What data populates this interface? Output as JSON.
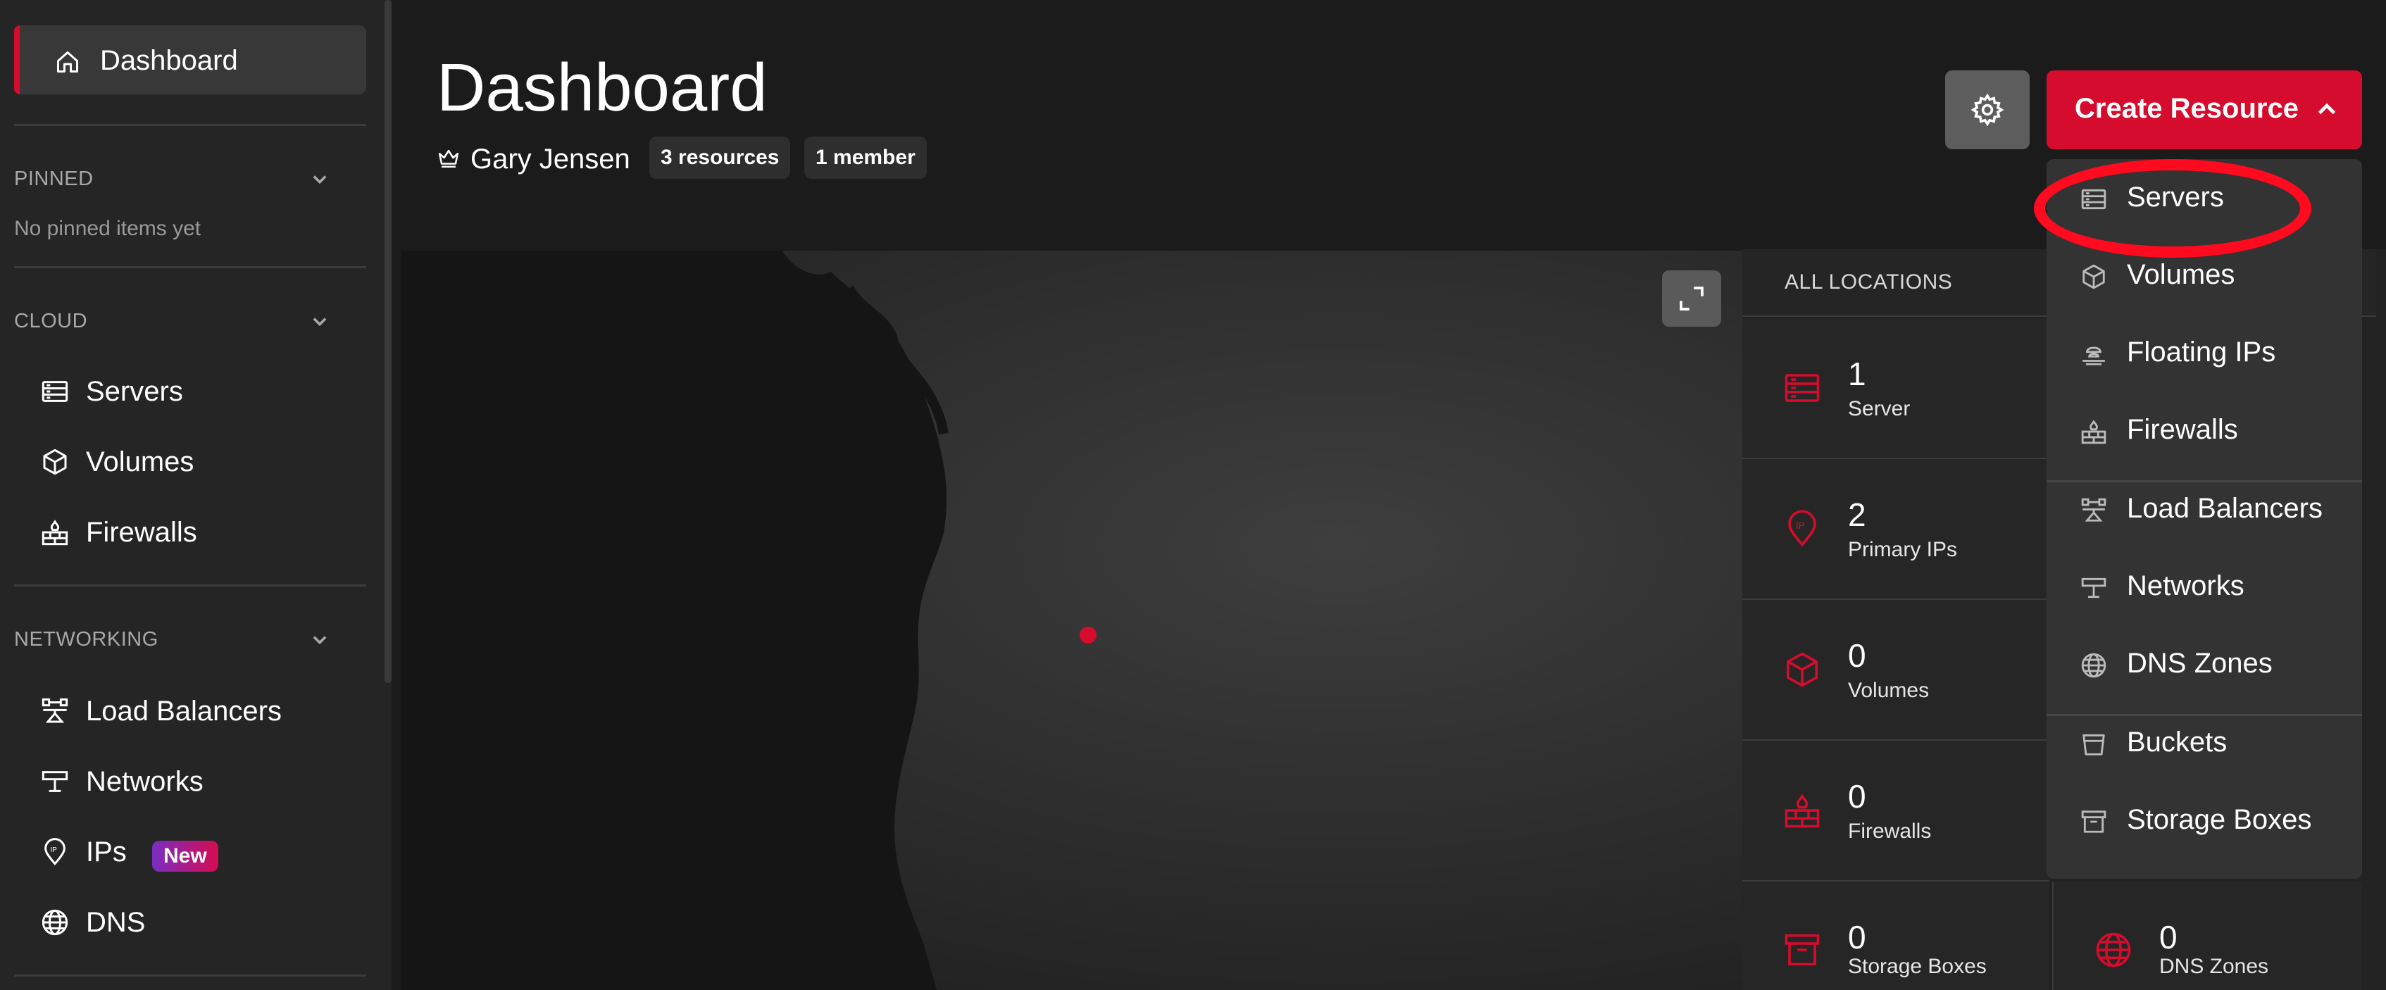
{
  "sidebar": {
    "dashboard_label": "Dashboard",
    "sections": {
      "pinned": {
        "title": "PINNED",
        "note": "No pinned items yet"
      },
      "cloud": {
        "title": "CLOUD",
        "items": [
          "Servers",
          "Volumes",
          "Firewalls"
        ]
      },
      "networking": {
        "title": "NETWORKING",
        "items": [
          "Load Balancers",
          "Networks",
          "IPs",
          "DNS"
        ],
        "ips_badge": "New"
      }
    }
  },
  "header": {
    "title": "Dashboard",
    "owner": "Gary Jensen",
    "resources_pill": "3 resources",
    "members_pill": "1 member",
    "create_label": "Create Resource"
  },
  "dropdown": {
    "items": [
      "Servers",
      "Volumes",
      "Floating IPs",
      "Firewalls",
      "Load Balancers",
      "Networks",
      "DNS Zones",
      "Buckets",
      "Storage Boxes"
    ]
  },
  "stats": {
    "header": "ALL LOCATIONS",
    "items": [
      {
        "value": "1",
        "label": "Server",
        "icon": "server-icon"
      },
      {
        "value": "2",
        "label": "Primary IPs",
        "icon": "ip-pin-icon"
      },
      {
        "value": "0",
        "label": "Volumes",
        "icon": "volume-cube-icon"
      },
      {
        "value": "0",
        "label": "Firewalls",
        "icon": "firewall-icon"
      },
      {
        "value": "0",
        "label": "Storage Boxes",
        "icon": "storage-box-icon"
      },
      {
        "value": "0",
        "label": "DNS Zones",
        "icon": "globe-icon"
      }
    ]
  },
  "colors": {
    "accent": "#d50c2d",
    "highlight": "#ff0a1e",
    "background": "#1b1b1b"
  }
}
